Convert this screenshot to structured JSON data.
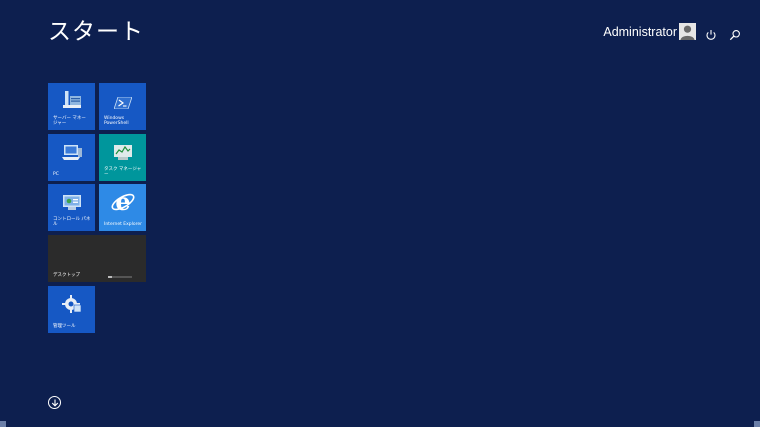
{
  "start": {
    "title": "スタート"
  },
  "user": {
    "name": "Administrator"
  },
  "icons": {
    "avatar": "user-avatar-icon",
    "power": "power-icon",
    "search": "search-icon",
    "apps": "apps-down-arrow-icon"
  },
  "tiles": [
    {
      "label": "サーバー マネー\nジャー",
      "color": "#1658c4",
      "icon": "server-manager-icon"
    },
    {
      "label": "Windows\nPowerShell",
      "color": "#1658c4",
      "icon": "powershell-icon"
    },
    {
      "label": "PC",
      "color": "#1658c4",
      "icon": "computer-icon"
    },
    {
      "label": "タスク マネージャー",
      "color": "#00969c",
      "icon": "task-manager-icon"
    },
    {
      "label": "コントロール パネル",
      "color": "#1658c4",
      "icon": "control-panel-icon"
    },
    {
      "label": "Internet Explorer",
      "color": "#2e8ae6",
      "icon": "internet-explorer-icon"
    },
    {
      "label": "デスクトップ",
      "color": "#2b2b2b",
      "icon": ""
    },
    {
      "label": "管理ツール",
      "color": "#1658c4",
      "icon": "admin-tools-icon"
    }
  ],
  "colors": {
    "background": "#0d1f4f"
  }
}
